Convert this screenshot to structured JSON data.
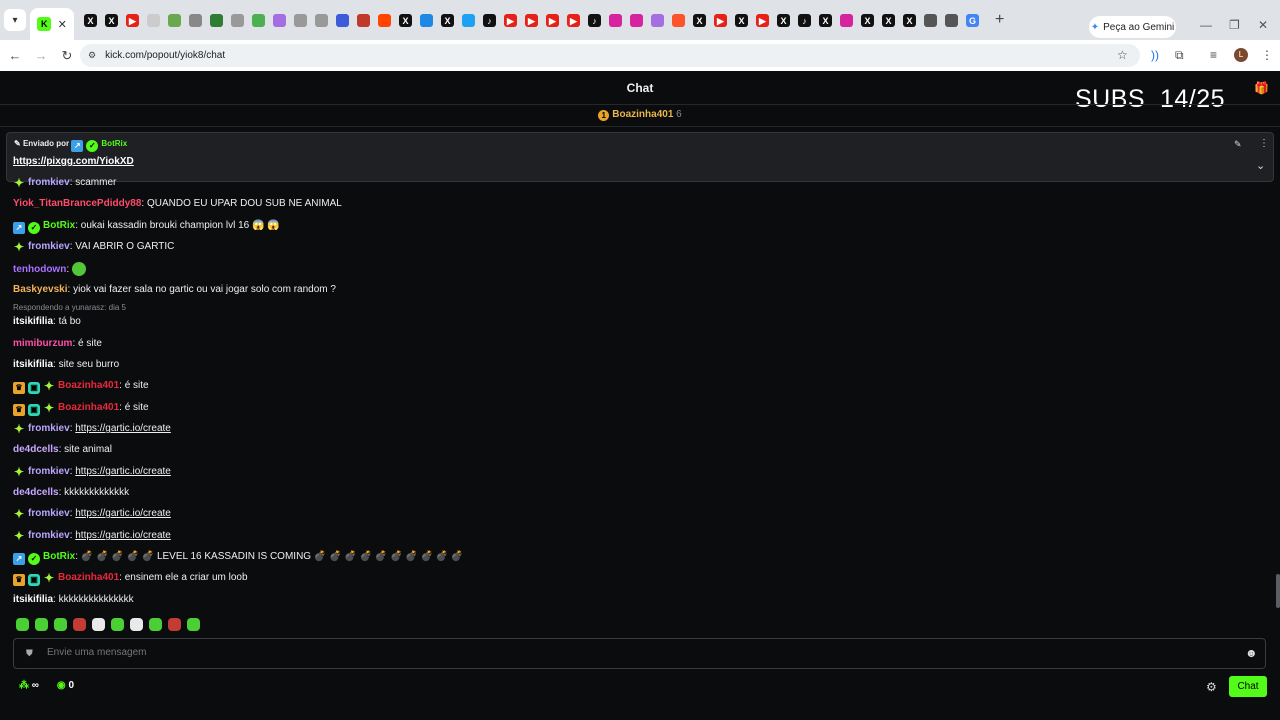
{
  "browser": {
    "url": "kick.com/popout/yiok8/chat",
    "gemini_label": "Peça ao Gemini",
    "profile_initial": "L"
  },
  "header": {
    "title": "Chat",
    "subs_overlay": "SUBS  14/25",
    "pinned_user": "Boazinha401",
    "pinned_count": "6"
  },
  "pinned": {
    "sent_by_label": "Enviado por",
    "sender": "BotRix",
    "link": "https://pixgg.com/YiokXD"
  },
  "messages": [
    {
      "user": "fromkiev",
      "color": "#b9a6ff",
      "badges": [
        "spark"
      ],
      "text": "scammer"
    },
    {
      "user": "Yiok_TitanBrancePdiddy88",
      "color": "#ff4b6e",
      "badges": [],
      "text": "QUANDO EU UPAR DOU SUB NE ANIMAL"
    },
    {
      "user": "BotRix",
      "color": "#53fc18",
      "badges": [
        "bot",
        "ver"
      ],
      "text": "oukai kassadin brouki champion lvl 16 😱 😱"
    },
    {
      "user": "fromkiev",
      "color": "#b9a6ff",
      "badges": [
        "spark"
      ],
      "text": "VAI ABRIR O GARTIC"
    },
    {
      "user": "tenhodown",
      "color": "#a970ff",
      "badges": [],
      "text": "",
      "emote": true
    },
    {
      "user": "Baskyevski",
      "color": "#f2b35b",
      "badges": [],
      "text": "yiok vai fazer sala no gartic ou vai jogar solo com random ?"
    },
    {
      "user": "itsikifilia",
      "color": "#ffffff",
      "badges": [],
      "text": "tá bo",
      "reply": "Respondendo a yunarasz: dia 5"
    },
    {
      "user": "mimiburzum",
      "color": "#ff4fa8",
      "badges": [],
      "text": "é site"
    },
    {
      "user": "itsikifilia",
      "color": "#ffffff",
      "badges": [],
      "text": "site seu burro"
    },
    {
      "user": "Boazinha401",
      "color": "#e8293c",
      "badges": [
        "crown",
        "gift",
        "spark"
      ],
      "text": "é site"
    },
    {
      "user": "Boazinha401",
      "color": "#e8293c",
      "badges": [
        "crown",
        "gift",
        "spark"
      ],
      "text": "é site"
    },
    {
      "user": "fromkiev",
      "color": "#b9a6ff",
      "badges": [
        "spark"
      ],
      "text": "https://gartic.io/create",
      "link": true
    },
    {
      "user": "de4dcells",
      "color": "#c8a8ff",
      "badges": [],
      "text": "site animal"
    },
    {
      "user": "fromkiev",
      "color": "#b9a6ff",
      "badges": [
        "spark"
      ],
      "text": "https://gartic.io/create",
      "link": true
    },
    {
      "user": "de4dcells",
      "color": "#c8a8ff",
      "badges": [],
      "text": "kkkkkkkkkkkkk"
    },
    {
      "user": "fromkiev",
      "color": "#b9a6ff",
      "badges": [
        "spark"
      ],
      "text": "https://gartic.io/create",
      "link": true
    },
    {
      "user": "fromkiev",
      "color": "#b9a6ff",
      "badges": [
        "spark"
      ],
      "text": "https://gartic.io/create",
      "link": true
    },
    {
      "user": "BotRix",
      "color": "#53fc18",
      "badges": [
        "bot",
        "ver"
      ],
      "text": "💣 💣 💣 💣 💣 LEVEL 16 KASSADIN IS COMING 💣 💣 💣 💣 💣 💣 💣 💣 💣 💣"
    },
    {
      "user": "Boazinha401",
      "color": "#e8293c",
      "badges": [
        "crown",
        "gift",
        "spark"
      ],
      "text": "ensinem ele a criar um loob"
    },
    {
      "user": "itsikifilia",
      "color": "#ffffff",
      "badges": [],
      "text": "kkkkkkkkkkkkkkk"
    }
  ],
  "composer": {
    "placeholder": "Envie uma mensagem",
    "send_label": "Chat"
  },
  "footer": {
    "infinity": "∞",
    "points": "0"
  }
}
